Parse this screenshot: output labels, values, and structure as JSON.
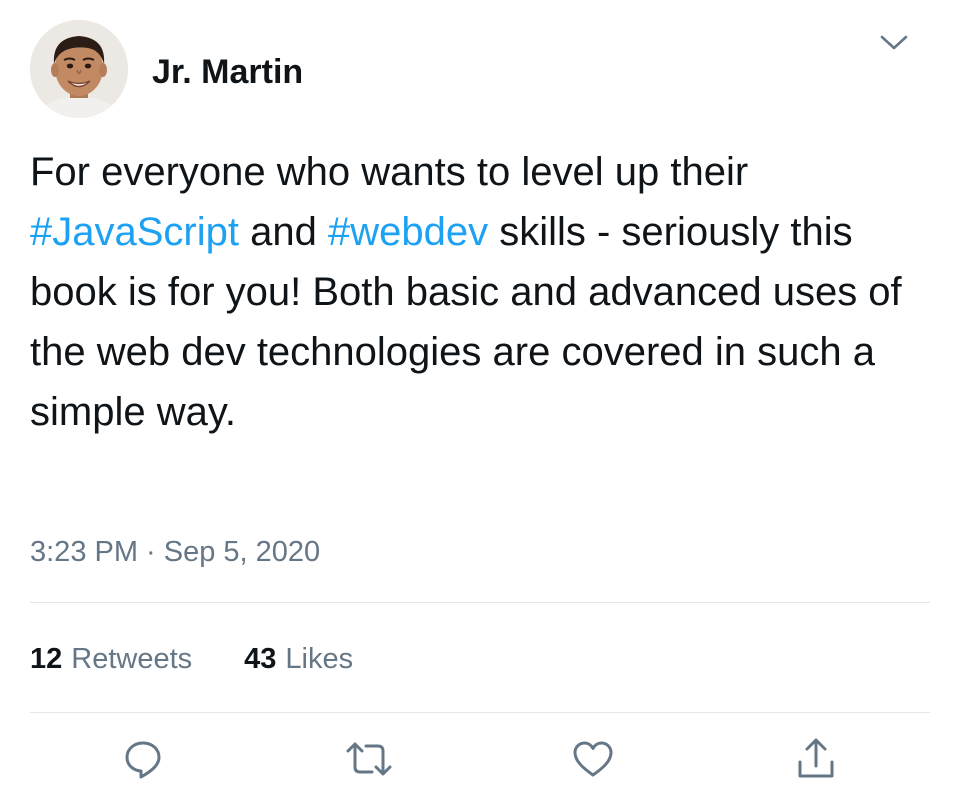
{
  "author": {
    "name": "Jr. Martin"
  },
  "tweet": {
    "segments": [
      {
        "text": "For everyone who wants to level up their ",
        "type": "text"
      },
      {
        "text": "#JavaScript",
        "type": "hashtag"
      },
      {
        "text": " and ",
        "type": "text"
      },
      {
        "text": "#webdev",
        "type": "hashtag"
      },
      {
        "text": " skills - seriously this book is for you! Both basic and advanced uses of the web dev technologies are covered in such a simple way.",
        "type": "text"
      }
    ],
    "timestamp": "3:23 PM · Sep 5, 2020"
  },
  "stats": {
    "retweets": {
      "count": "12",
      "label": "Retweets"
    },
    "likes": {
      "count": "43",
      "label": "Likes"
    }
  },
  "actions": {
    "reply": "reply-icon",
    "retweet": "retweet-icon",
    "like": "heart-icon",
    "share": "share-icon"
  },
  "menu_icon": "chevron-down-icon",
  "colors": {
    "text": "#0f1419",
    "hashtag": "#1da1f2",
    "secondary": "#657786",
    "icon": "#657786",
    "divider": "#e1e8ed"
  }
}
